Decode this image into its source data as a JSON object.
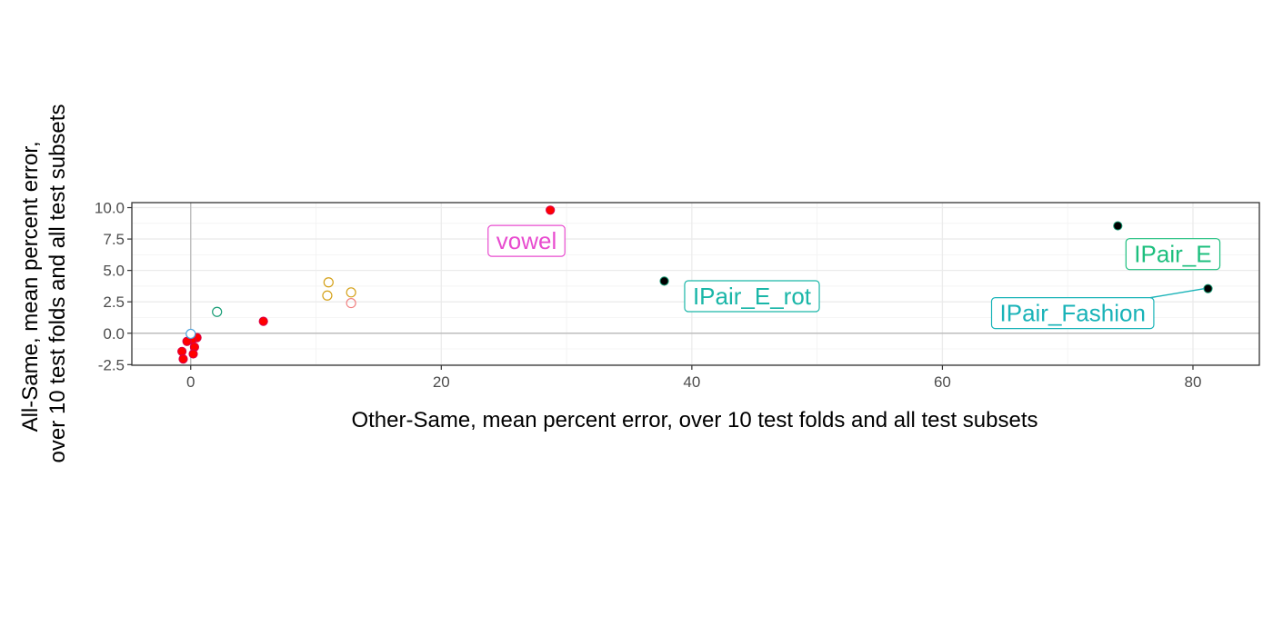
{
  "chart_data": {
    "type": "scatter",
    "xlabel": "Other-Same, mean percent error, over 10 test folds and all test subsets",
    "ylabel": [
      "All-Same, mean percent error,",
      "over 10 test folds and all test subsets"
    ],
    "xlim": [
      -4.7,
      85.3
    ],
    "ylim": [
      -2.55,
      10.4
    ],
    "x_ticks": [
      0,
      20,
      40,
      60,
      80
    ],
    "x_tick_labels": [
      "0",
      "20",
      "40",
      "60",
      "80"
    ],
    "y_ticks": [
      -2.5,
      0,
      2.5,
      5,
      7.5,
      10
    ],
    "y_tick_labels": [
      "-2.5",
      "0.0",
      "2.5",
      "5.0",
      "7.5",
      "10.0"
    ],
    "grid": true,
    "reference_lines": {
      "x": 0,
      "y": 0
    },
    "series": [
      {
        "marker": "filled",
        "fill": "#ff0000",
        "stroke": "#d9004a",
        "points": [
          {
            "x": 28.7,
            "y": 9.8
          },
          {
            "x": 5.8,
            "y": 0.95
          },
          {
            "x": 0.5,
            "y": -0.35
          },
          {
            "x": 0.1,
            "y": -0.55
          },
          {
            "x": -0.3,
            "y": -0.65
          },
          {
            "x": 0.3,
            "y": -1.1
          },
          {
            "x": -0.7,
            "y": -1.45
          },
          {
            "x": 0.2,
            "y": -1.65
          },
          {
            "x": -0.6,
            "y": -2.05
          }
        ]
      },
      {
        "marker": "filled",
        "fill": "#000000",
        "stroke": "#1a9e77",
        "points": [
          {
            "x": 74.0,
            "y": 8.55
          },
          {
            "x": 37.8,
            "y": 4.15
          },
          {
            "x": 81.2,
            "y": 3.55
          }
        ]
      },
      {
        "marker": "open",
        "fill": "none",
        "stroke": "#d4a017",
        "points": [
          {
            "x": 11.0,
            "y": 4.05
          },
          {
            "x": 10.9,
            "y": 3.0
          },
          {
            "x": 12.8,
            "y": 3.25
          }
        ]
      },
      {
        "marker": "open",
        "fill": "none",
        "stroke": "#f08080",
        "points": [
          {
            "x": 12.8,
            "y": 2.4
          }
        ]
      },
      {
        "marker": "open",
        "fill": "none",
        "stroke": "#1a9e77",
        "points": [
          {
            "x": 2.1,
            "y": 1.7
          }
        ]
      },
      {
        "marker": "open",
        "fill": "#ffffff",
        "stroke": "#4aa3df",
        "points": [
          {
            "x": 0.0,
            "y": -0.05
          }
        ]
      }
    ],
    "annotations": [
      {
        "text": "vowel",
        "color": "#e84ccf",
        "x": 28.7,
        "y": 9.8,
        "box_center": [
          26.8,
          7.35
        ],
        "leader": false
      },
      {
        "text": "IPair_E",
        "color": "#1dbf7e",
        "x": 74.0,
        "y": 8.55,
        "box_center": [
          78.4,
          6.3
        ],
        "leader": false
      },
      {
        "text": "IPair_E_rot",
        "color": "#1ab6a8",
        "x": 37.8,
        "y": 4.15,
        "box_center": [
          44.8,
          2.95
        ],
        "leader": false
      },
      {
        "text": "IPair_Fashion",
        "color": "#19b3b8",
        "x": 81.2,
        "y": 3.55,
        "box_center": [
          70.4,
          1.6
        ],
        "leader": true
      }
    ]
  }
}
